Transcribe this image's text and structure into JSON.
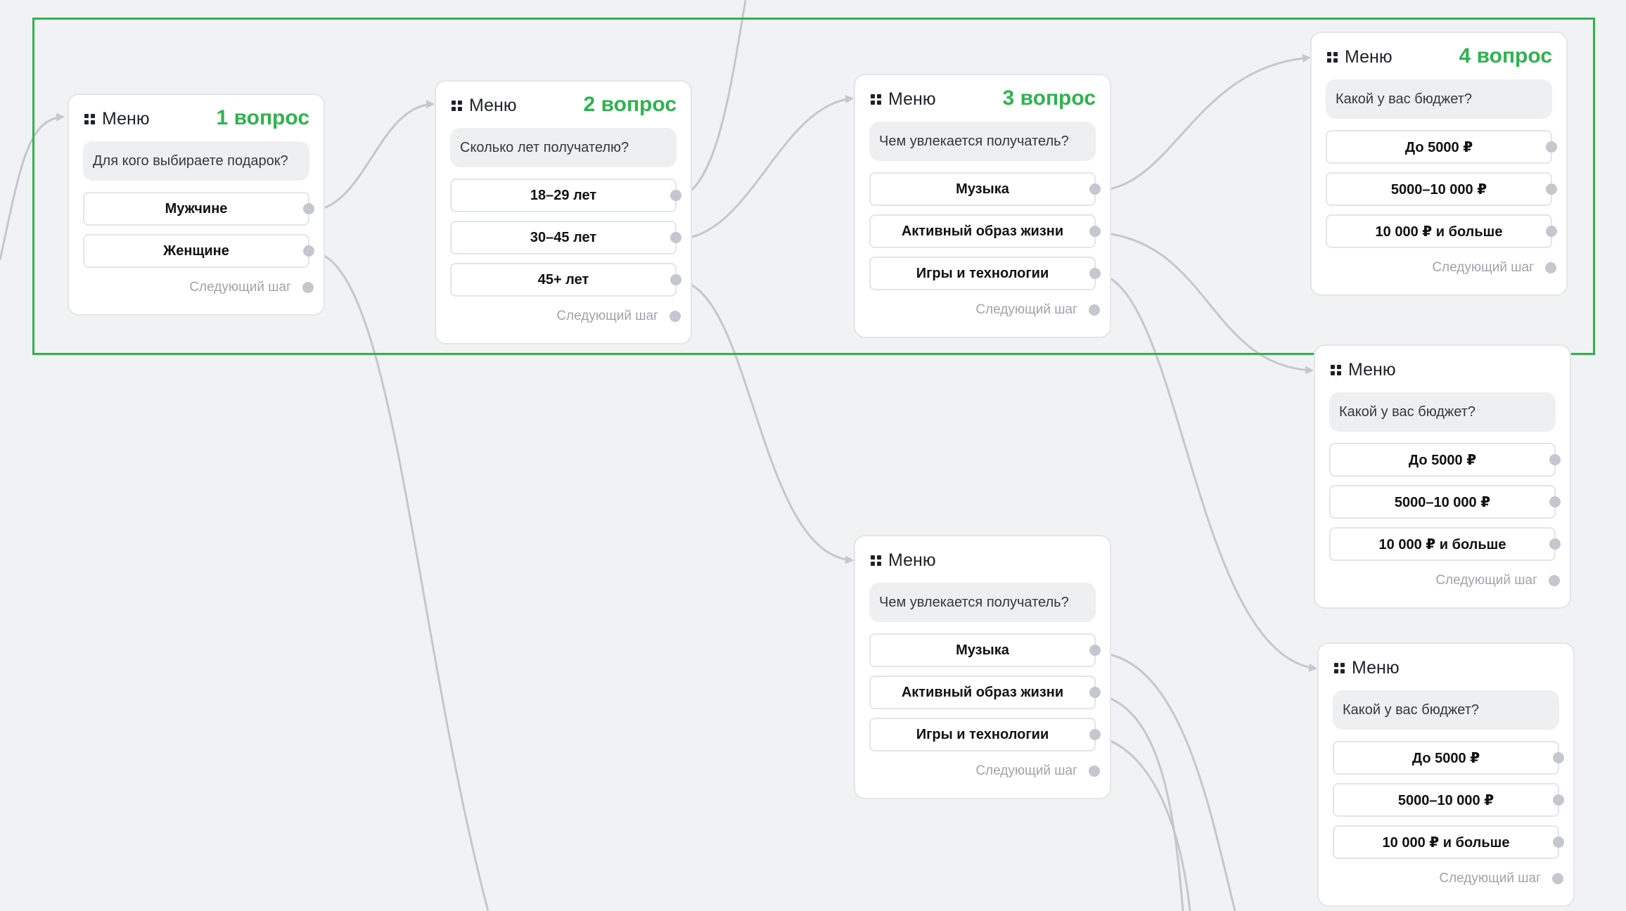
{
  "menu_title": "Меню",
  "next_step_label": "Следующий шаг",
  "colors": {
    "accent": "#2eb34f",
    "edge": "#c4c7cd",
    "canvas": "#f1f2f4"
  },
  "icons": {
    "drag": "drag-handle-icon",
    "port": "connector-dot",
    "arrow": "arrow-head-icon"
  },
  "nodes": [
    {
      "id": "n1",
      "question_label": "1 вопрос",
      "message": "Для кого выбираете подарок?",
      "options": [
        "Мужчине",
        "Женщине"
      ]
    },
    {
      "id": "n2",
      "question_label": "2 вопрос",
      "message": "Сколько лет получателю?",
      "options": [
        "18–29 лет",
        "30–45 лет",
        "45+ лет"
      ]
    },
    {
      "id": "n3",
      "question_label": "3 вопрос",
      "message": "Чем увлекается получатель?",
      "options": [
        "Музыка",
        "Активный образ жизни",
        "Игры и технологии"
      ]
    },
    {
      "id": "n4",
      "question_label": "4 вопрос",
      "message": "Какой у вас бюджет?",
      "options": [
        "До 5000 ₽",
        "5000–10 000 ₽",
        "10 000 ₽ и больше"
      ]
    },
    {
      "id": "n5",
      "question_label": "",
      "message": "Какой у вас бюджет?",
      "options": [
        "До 5000 ₽",
        "5000–10 000 ₽",
        "10 000 ₽ и больше"
      ]
    },
    {
      "id": "n6",
      "question_label": "",
      "message": "Чем увлекается получатель?",
      "options": [
        "Музыка",
        "Активный образ жизни",
        "Игры и технологии"
      ]
    },
    {
      "id": "n7",
      "question_label": "",
      "message": "Какой у вас бюджет?",
      "options": [
        "До 5000 ₽",
        "5000–10 000 ₽",
        "10 000 ₽ и больше"
      ]
    }
  ],
  "connections": [
    {
      "from": "n1.option.0",
      "to": "n2"
    },
    {
      "from": "n1.option.1",
      "to": "offscreen-below"
    },
    {
      "from": "n2.option.0",
      "to": "offscreen-above"
    },
    {
      "from": "n2.option.1",
      "to": "n3"
    },
    {
      "from": "n2.option.2",
      "to": "n6"
    },
    {
      "from": "n3.option.0",
      "to": "n4"
    },
    {
      "from": "n3.option.1",
      "to": "n5"
    },
    {
      "from": "n3.option.2",
      "to": "n7"
    },
    {
      "from": "n6.option.0",
      "to": "offscreen-below"
    },
    {
      "from": "n6.option.1",
      "to": "offscreen-below"
    },
    {
      "from": "n6.option.2",
      "to": "offscreen-below"
    },
    {
      "from": "offscreen-left",
      "to": "n1"
    }
  ]
}
